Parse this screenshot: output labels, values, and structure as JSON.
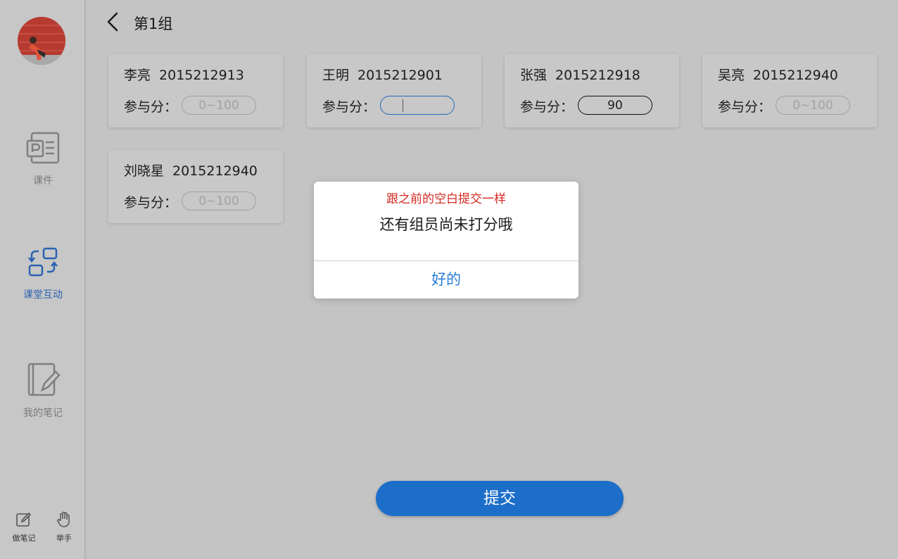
{
  "sidebar": {
    "nav": [
      {
        "label": "课件",
        "icon": "courseware-icon"
      },
      {
        "label": "课堂互动",
        "icon": "interaction-icon",
        "active": true
      },
      {
        "label": "我的笔记",
        "icon": "notebook-icon"
      }
    ],
    "tools": [
      {
        "label": "做笔记",
        "icon": "edit-note-icon"
      },
      {
        "label": "举手",
        "icon": "raise-hand-icon"
      }
    ]
  },
  "header": {
    "title": "第1组"
  },
  "score_label": "参与分：",
  "placeholder": "0~100",
  "members": [
    {
      "name": "李亮",
      "id": "2015212913",
      "score": ""
    },
    {
      "name": "王明",
      "id": "2015212901",
      "score": ""
    },
    {
      "name": "张强",
      "id": "2015212918",
      "score": "90"
    },
    {
      "name": "吴亮",
      "id": "2015212940",
      "score": ""
    },
    {
      "name": "刘晓星",
      "id": "2015212940",
      "score": ""
    }
  ],
  "submit_label": "提交",
  "dialog": {
    "note": "跟之前的空白提交一样",
    "message": "还有组员尚未打分哦",
    "ok_label": "好的"
  },
  "colors": {
    "accent": "#1c6ec9",
    "active_nav": "#2a62b0",
    "note_red": "#d42a22",
    "ok_blue": "#2a7fd6"
  }
}
